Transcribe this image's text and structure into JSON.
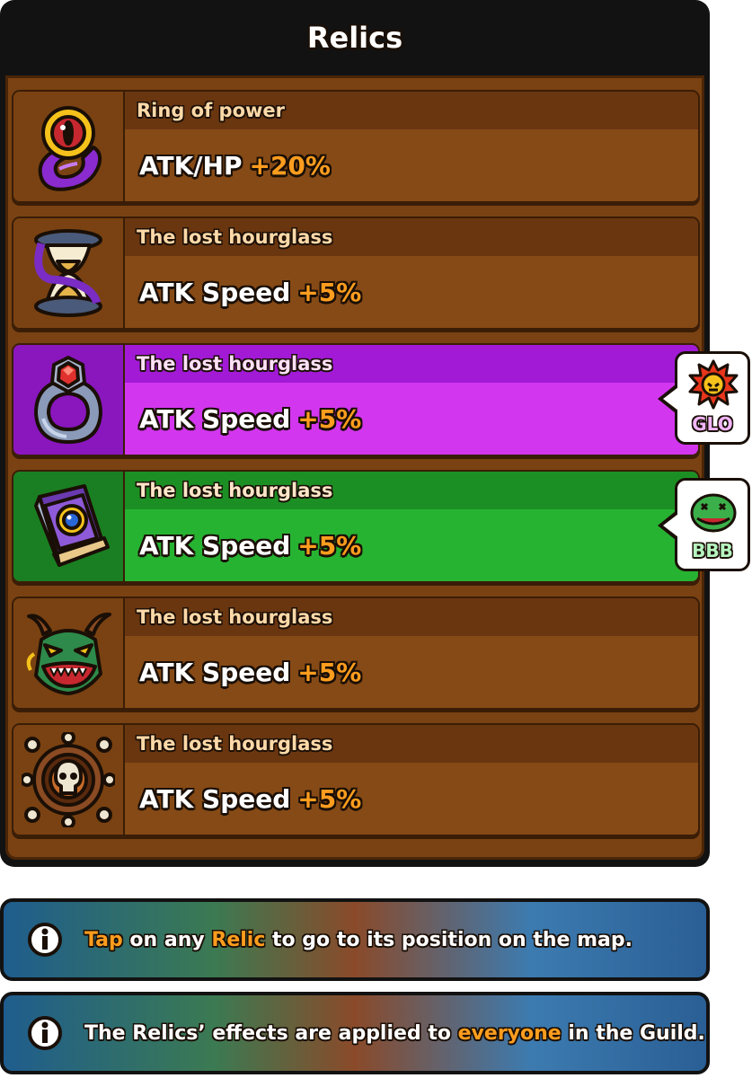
{
  "panel": {
    "title": "Relics"
  },
  "relics": [
    {
      "name": "Ring of power",
      "stat": "ATK/HP",
      "bonus": "+20%",
      "icon": "ring-icon",
      "theme": "brown"
    },
    {
      "name": "The lost hourglass",
      "stat": "ATK Speed",
      "bonus": "+5%",
      "icon": "hourglass-icon",
      "theme": "brown"
    },
    {
      "name": "The lost hourglass",
      "stat": "ATK Speed",
      "bonus": "+5%",
      "icon": "gem-ring-icon",
      "theme": "purple",
      "owner": {
        "tag": "GLO",
        "icon": "spiky-emblem-icon"
      }
    },
    {
      "name": "The lost hourglass",
      "stat": "ATK Speed",
      "bonus": "+5%",
      "icon": "spellbook-icon",
      "theme": "green",
      "owner": {
        "tag": "BBB",
        "icon": "frog-face-icon"
      }
    },
    {
      "name": "The lost hourglass",
      "stat": "ATK Speed",
      "bonus": "+5%",
      "icon": "dragon-mask-icon",
      "theme": "brown"
    },
    {
      "name": "The lost hourglass",
      "stat": "ATK Speed",
      "bonus": "+5%",
      "icon": "skull-wheel-icon",
      "theme": "brown"
    }
  ],
  "info": [
    {
      "parts": [
        "Tap",
        " on any ",
        "Relic",
        " to go to its position on the map."
      ]
    },
    {
      "parts": [
        "The Relics’ effects are applied to ",
        "everyone",
        " in the Guild."
      ]
    }
  ],
  "colors": {
    "accent": "#ff9d1e",
    "panel_bg": "#7a4212",
    "glo_tag": "#c84bd8",
    "bbb_tag": "#2ea84a"
  }
}
